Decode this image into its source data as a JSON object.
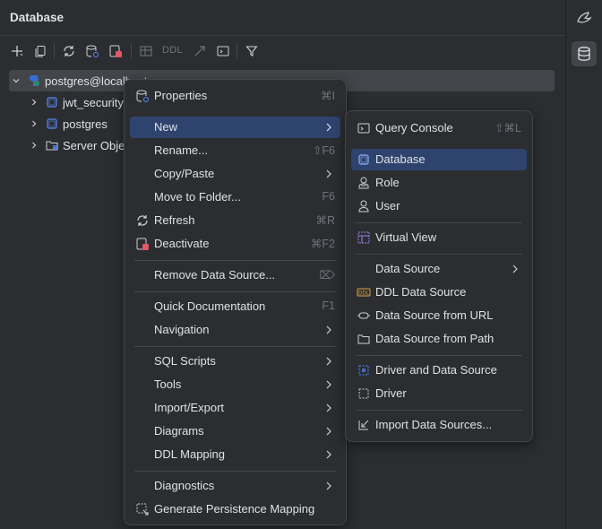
{
  "panel": {
    "title": "Database"
  },
  "toolbar": {
    "ddl_label": "DDL"
  },
  "tree": {
    "root": "postgres@localhost",
    "children": [
      "jwt_security",
      "postgres",
      "Server Objects"
    ]
  },
  "context_menu": {
    "items": [
      {
        "label": "Properties",
        "shortcut": "⌘I",
        "icon": "properties-icon"
      },
      {
        "label": "New",
        "submenu": true
      },
      {
        "label": "Rename...",
        "shortcut": "⇧F6"
      },
      {
        "label": "Copy/Paste",
        "submenu": true
      },
      {
        "label": "Move to Folder...",
        "shortcut": "F6"
      },
      {
        "label": "Refresh",
        "shortcut": "⌘R",
        "icon": "refresh-icon"
      },
      {
        "label": "Deactivate",
        "shortcut": "⌘F2",
        "icon": "deactivate-icon"
      },
      {
        "label": "Remove Data Source...",
        "shortcut": "⌦"
      },
      {
        "label": "Quick Documentation",
        "shortcut": "F1"
      },
      {
        "label": "Navigation",
        "submenu": true
      },
      {
        "label": "SQL Scripts",
        "submenu": true
      },
      {
        "label": "Tools",
        "submenu": true
      },
      {
        "label": "Import/Export",
        "submenu": true
      },
      {
        "label": "Diagrams",
        "submenu": true
      },
      {
        "label": "DDL Mapping",
        "submenu": true
      },
      {
        "label": "Diagnostics",
        "submenu": true
      },
      {
        "label": "Generate Persistence Mapping",
        "icon": "persistence-icon"
      }
    ]
  },
  "new_submenu": {
    "items": [
      {
        "label": "Query Console",
        "shortcut": "⇧⌘L",
        "icon": "console-icon"
      },
      {
        "label": "Database",
        "icon": "database-icon"
      },
      {
        "label": "Role",
        "icon": "role-icon"
      },
      {
        "label": "User",
        "icon": "user-icon"
      },
      {
        "label": "Virtual View",
        "icon": "virtual-view-icon"
      },
      {
        "label": "Data Source",
        "submenu": true
      },
      {
        "label": "DDL Data Source",
        "icon": "ddl-icon"
      },
      {
        "label": "Data Source from URL",
        "icon": "url-icon"
      },
      {
        "label": "Data Source from Path",
        "icon": "folder-icon"
      },
      {
        "label": "Driver and Data Source",
        "icon": "driver-datasource-icon"
      },
      {
        "label": "Driver",
        "icon": "driver-icon"
      },
      {
        "label": "Import Data Sources...",
        "icon": "import-icon"
      }
    ]
  },
  "colors": {
    "highlight": "#2e436e",
    "background": "#2b2d30",
    "accent": "#3574f0"
  }
}
